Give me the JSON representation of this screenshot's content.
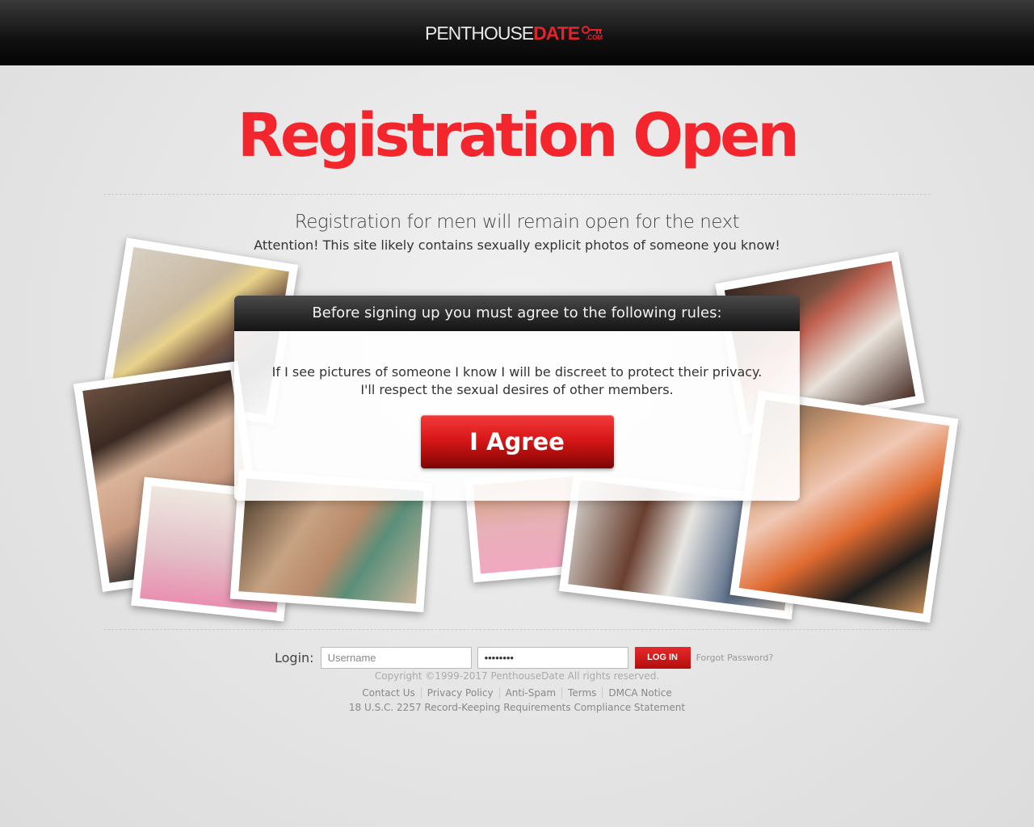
{
  "header": {
    "logo_main": "PENTHOUSE",
    "logo_accent": "DATE",
    "logo_suffix": ".COM"
  },
  "headline": "Registration Open",
  "subheadline": "Registration for men will remain open for the next",
  "attention": "Attention! This site likely contains sexually explicit photos of someone you know!",
  "modal": {
    "title": "Before signing up you must agree to the following rules:",
    "rules": [
      "If I see pictures of someone I know I will be discreet to protect their privacy.",
      "I'll respect the sexual desires of other members."
    ],
    "agree_label": "I Agree"
  },
  "login": {
    "label": "Login:",
    "username_placeholder": "Username",
    "password_value": "••••••••",
    "button_label": "LOG IN",
    "forgot_label": "Forgot Password?"
  },
  "footer": {
    "copyright": "Copyright ©1999-2017 PenthouseDate All rights reserved.",
    "links": [
      "Contact Us",
      "Privacy Policy",
      "Anti-Spam",
      "Terms",
      "DMCA Notice"
    ],
    "compliance": "18 U.S.C. 2257 Record-Keeping Requirements Compliance Statement"
  },
  "colors": {
    "accent": "#f2262c",
    "header_bg": "#111111",
    "agree_button": "#d81818"
  }
}
